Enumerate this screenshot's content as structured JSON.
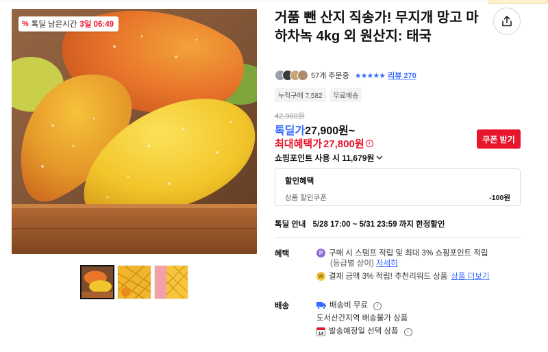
{
  "badge": {
    "label": "톡딜 남은시간",
    "time": "3일 06:49"
  },
  "product": {
    "title": "거품 뺀 산지 직송가! 무지개 망고 마하차녹 4kg 외 원산지: 태국"
  },
  "meta": {
    "orders": "57개 주문중",
    "stars": "★★★★★",
    "review": "리뷰 270"
  },
  "tags": [
    "누적구매 7,582",
    "무료배송"
  ],
  "price": {
    "original": "42,900원",
    "deal_label": "톡딜가",
    "deal_value": "27,900원~",
    "max_label": "최대혜택가",
    "max_value": "27,800원",
    "coupon_button": "쿠폰 받기",
    "points": "쇼핑포인트 사용 시 11,679원"
  },
  "discount": {
    "header": "할인혜택",
    "item": "상품 할인쿠폰",
    "amount": "-100원"
  },
  "deal_info": {
    "label": "톡딜 안내",
    "period": "5/28 17:00 ~ 5/31 23:59 까지 한정할인"
  },
  "benefits": {
    "label": "혜택",
    "line1": "구매 시 스탬프 적립 및 최대 3% 쇼핑포인트 적립",
    "line1b": "(등급별 상이)",
    "line1_link": "자세히",
    "line2": "결제 금액 3% 적립! 추천리워드 상품",
    "line2_link": "상품 더보기"
  },
  "shipping": {
    "label": "배송",
    "fee": "배송비 무료",
    "restriction": "도서산간지역 배송불가 상품",
    "schedule": "발송예정일 선택 상품",
    "cal_day": "14"
  },
  "colors": {
    "accent_red": "#e8162d",
    "accent_blue": "#346aff"
  },
  "icons": [
    "share-icon",
    "info-icon",
    "chevron-down-icon",
    "truck-icon",
    "calendar-icon",
    "p-point-icon",
    "coin-icon"
  ]
}
